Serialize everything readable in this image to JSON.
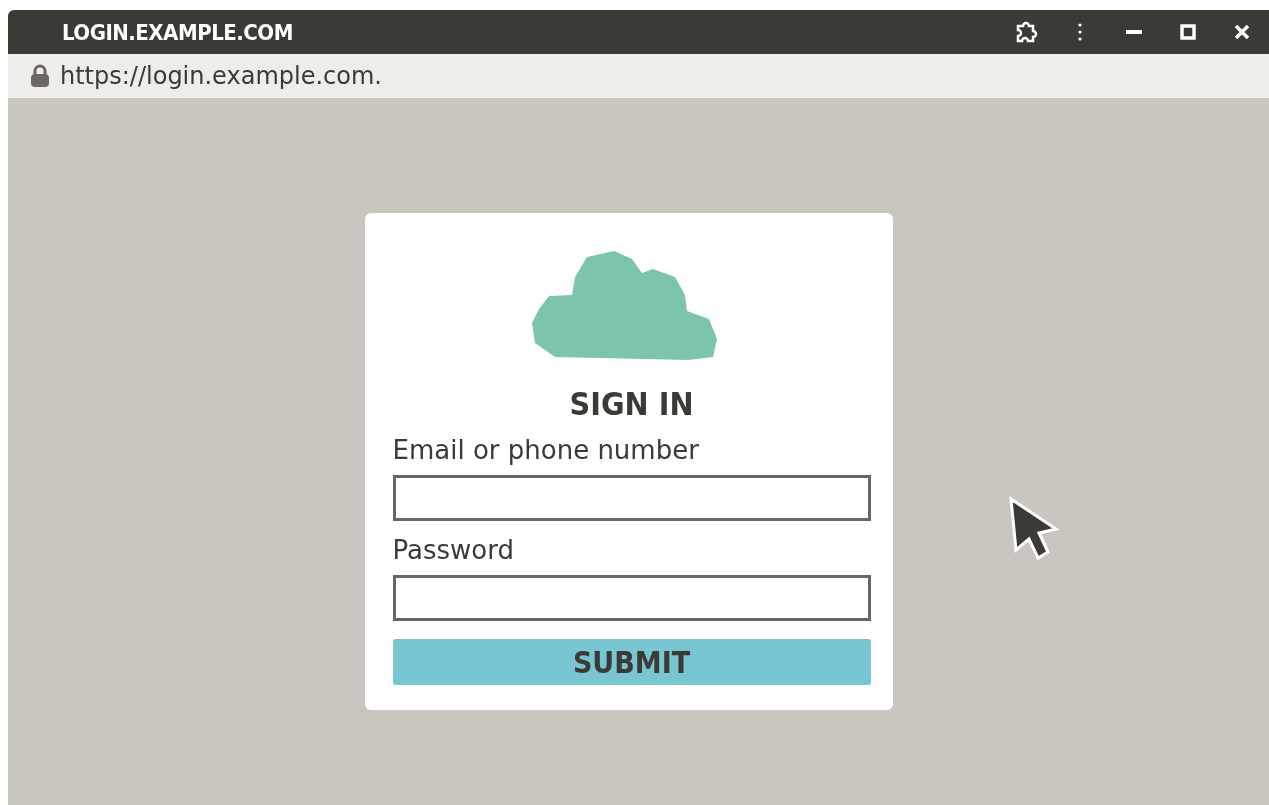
{
  "window": {
    "title": "LOGIN.EXAMPLE.COM"
  },
  "address_bar": {
    "url": "https://login.example.com."
  },
  "form": {
    "title": "SIGN IN",
    "fields": [
      {
        "label": "Email or phone number"
      },
      {
        "label": "Password"
      }
    ],
    "submit": "SUBMIT"
  }
}
